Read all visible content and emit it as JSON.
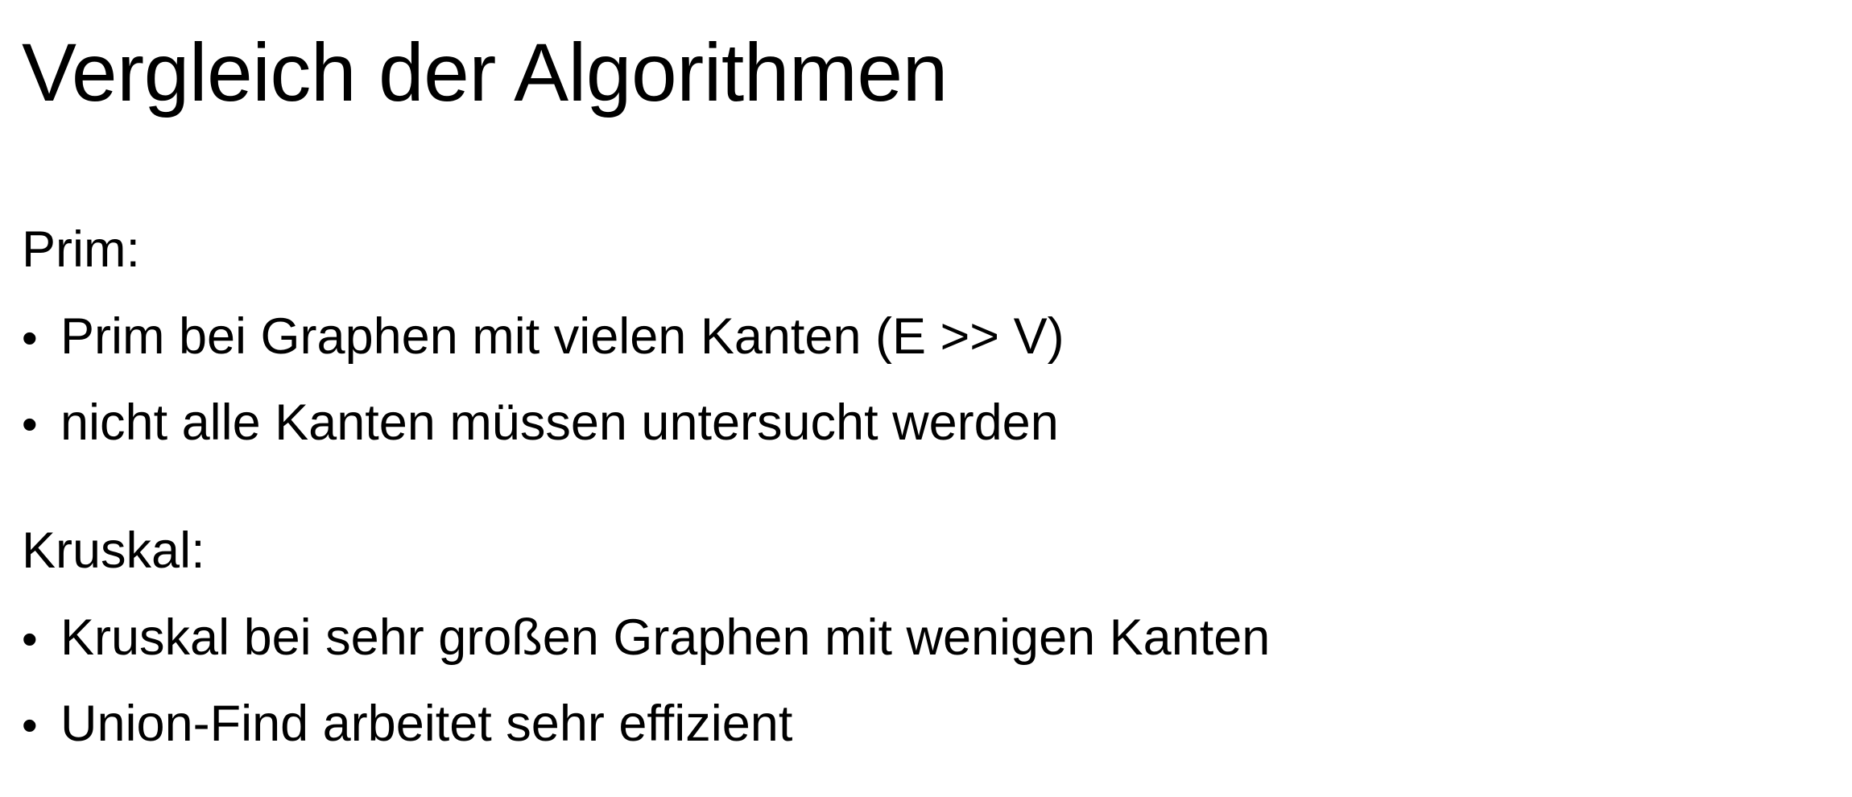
{
  "slide": {
    "title": "Vergleich der Algorithmen",
    "sections": [
      {
        "heading": "Prim:",
        "bullets": [
          "Prim bei Graphen mit vielen Kanten (E >> V)",
          "nicht alle Kanten müssen untersucht werden"
        ]
      },
      {
        "heading": "Kruskal:",
        "bullets": [
          "Kruskal bei sehr großen Graphen mit wenigen Kanten",
          "Union-Find arbeitet sehr effizient"
        ]
      }
    ],
    "bullet_glyph": "•"
  }
}
